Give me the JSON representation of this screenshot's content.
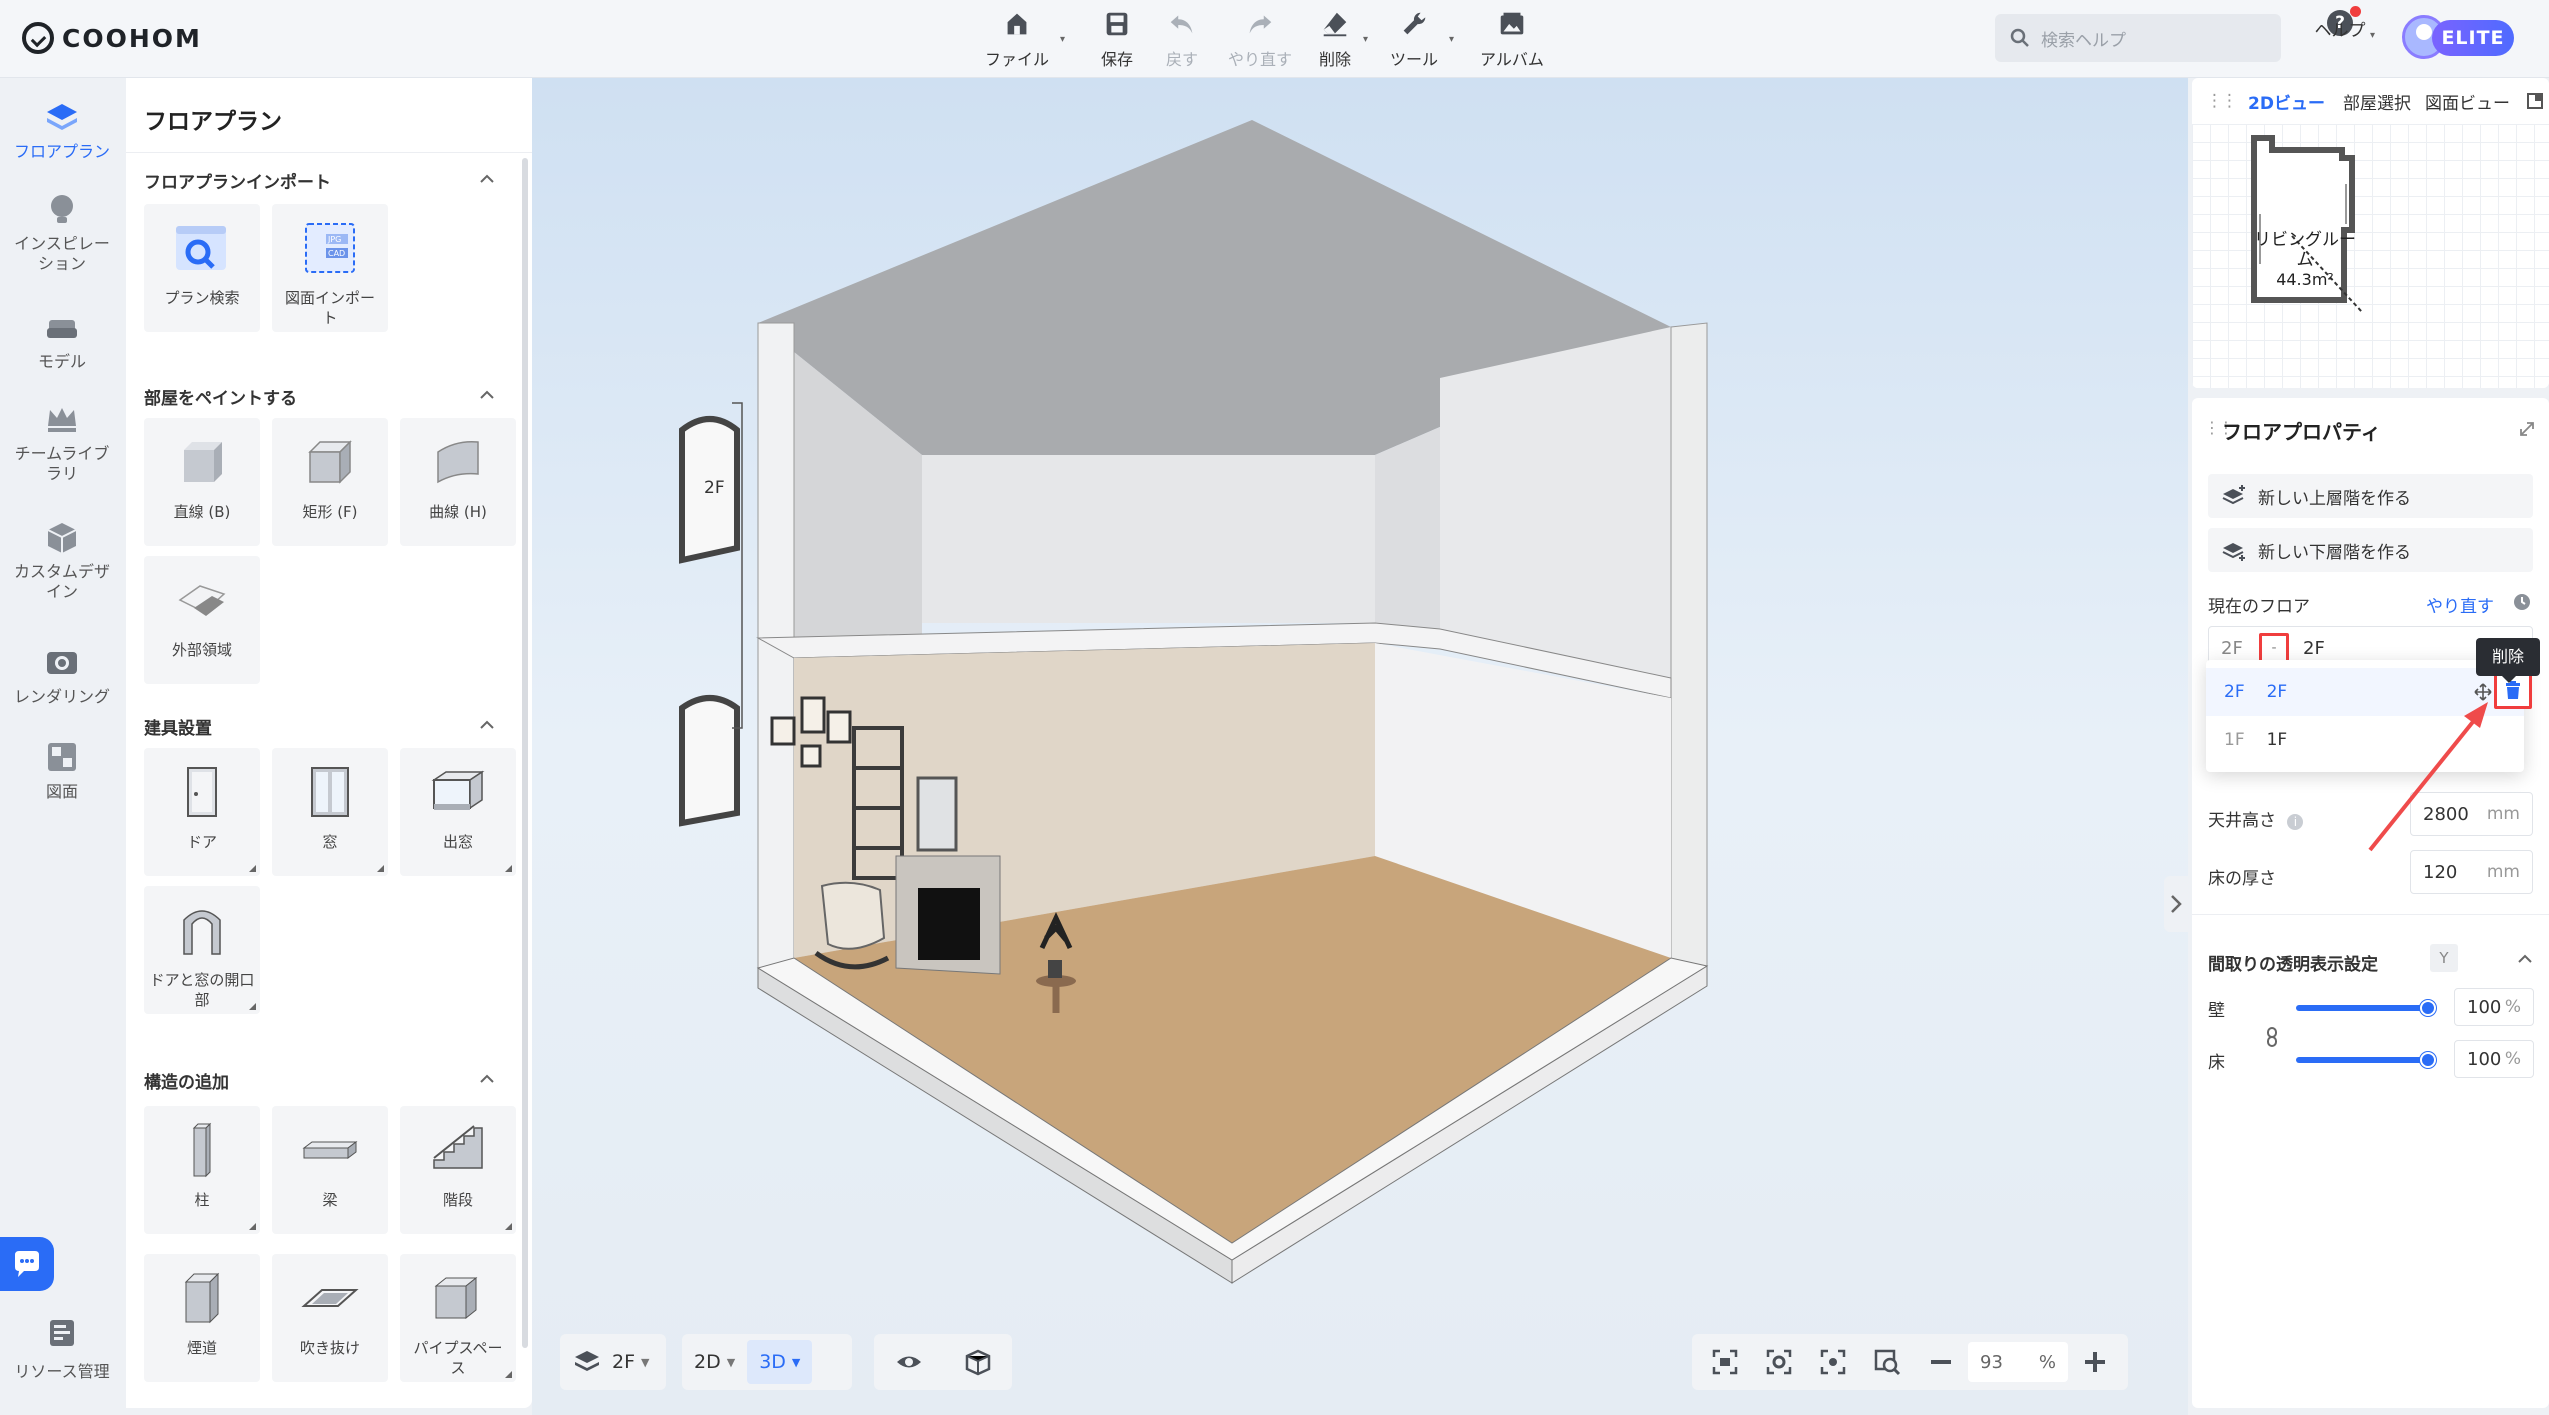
{
  "app": {
    "name": "COOHOM",
    "badge": "ELITE"
  },
  "toolbar": {
    "file": "ファイル",
    "save": "保存",
    "undo": "戻す",
    "redo": "やり直す",
    "delete": "削除",
    "tools": "ツール",
    "album": "アルバム"
  },
  "search": {
    "placeholder": "検索ヘルプ"
  },
  "help": {
    "label": "ヘルプ"
  },
  "rail": {
    "items": [
      {
        "label": "フロアプラン",
        "icon": "floorplan-icon",
        "active": true
      },
      {
        "label": "インスピレーション",
        "icon": "lightbulb-icon"
      },
      {
        "label": "モデル",
        "icon": "sofa-icon"
      },
      {
        "label": "チームライブラリ",
        "icon": "crown-icon"
      },
      {
        "label": "カスタムデザイン",
        "icon": "box-icon"
      },
      {
        "label": "レンダリング",
        "icon": "camera-icon"
      },
      {
        "label": "図面",
        "icon": "drawing-icon"
      }
    ],
    "resource": "リソース管理"
  },
  "panel": {
    "title": "フロアプラン",
    "sections": [
      {
        "title": "フロアプランインポート",
        "tiles": [
          "プラン検索",
          "図面インポート"
        ]
      },
      {
        "title": "部屋をペイントする",
        "tiles": [
          "直線 (B)",
          "矩形 (F)",
          "曲線 (H)",
          "外部領域"
        ]
      },
      {
        "title": "建具設置",
        "tiles": [
          "ドア",
          "窓",
          "出窓",
          "ドアと窓の開口部"
        ]
      },
      {
        "title": "構造の追加",
        "tiles": [
          "柱",
          "梁",
          "階段",
          "煙道",
          "吹き抜け",
          "パイプスペース"
        ]
      }
    ]
  },
  "canvas": {
    "floor_marker": "2F"
  },
  "bottom": {
    "floor": "2F",
    "view2d": "2D",
    "view3d": "3D",
    "zoom": "93",
    "zoom_unit": "%"
  },
  "minimap": {
    "tabs": [
      "2Dビュー",
      "部屋選択",
      "図面ビュー"
    ],
    "active_tab": "2Dビュー",
    "room_name": "リビングルーム",
    "room_area": "44.3m²"
  },
  "floor_props": {
    "title": "フロアプロパティ",
    "new_upper": "新しい上層階を作る",
    "new_lower": "新しい下層階を作る",
    "current_floor_label": "現在のフロア",
    "redo_link": "やり直す",
    "current_floor_code": "2F",
    "current_floor_name": "2F",
    "dropdown": [
      {
        "code": "2F",
        "name": "2F",
        "selected": true
      },
      {
        "code": "1F",
        "name": "1F",
        "selected": false
      }
    ],
    "tooltip": "削除",
    "ceiling_label": "天井高さ",
    "ceiling_value": "2800",
    "floor_thickness_label": "床の厚さ",
    "floor_thickness_value": "120",
    "unit_mm": "mm",
    "transparency_title": "間取りの透明表示設定",
    "transparency_key": "Y",
    "wall_label": "壁",
    "wall_value": "100",
    "floor_label": "床",
    "floor_value": "100",
    "pct": "%",
    "wall_opacity": 1.0,
    "floor_opacity": 1.0
  },
  "colors": {
    "accent": "#2a6cf6",
    "highlight": "#f03d3d",
    "arrow": "#ef4b4b"
  }
}
